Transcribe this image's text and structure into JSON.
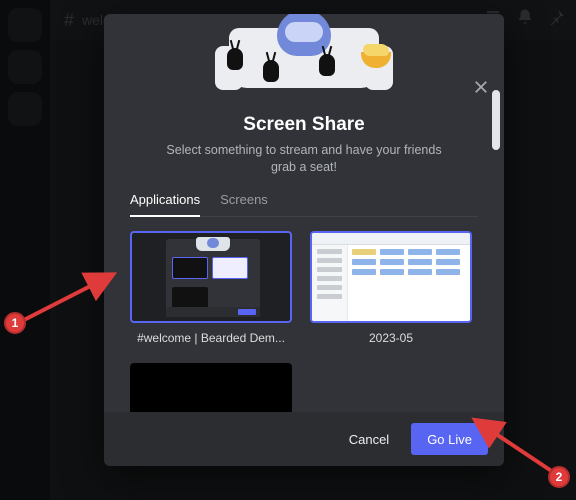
{
  "background": {
    "channel_prefix": "#",
    "channel_name": "welcome"
  },
  "modal": {
    "title": "Screen Share",
    "subtitle": "Select something to stream and have your friends grab a seat!",
    "tabs": [
      {
        "label": "Applications",
        "active": true
      },
      {
        "label": "Screens",
        "active": false
      }
    ],
    "sources": [
      {
        "label": "#welcome | Bearded Dem..."
      },
      {
        "label": "2023-05"
      },
      {
        "label": ""
      }
    ],
    "footer": {
      "cancel": "Cancel",
      "go_live": "Go Live"
    }
  },
  "annotations": {
    "step1": "1",
    "step2": "2"
  },
  "colors": {
    "accent": "#5865f2",
    "modal_bg": "#313338",
    "footer_bg": "#2b2d31",
    "annotation": "#e03b3b"
  }
}
